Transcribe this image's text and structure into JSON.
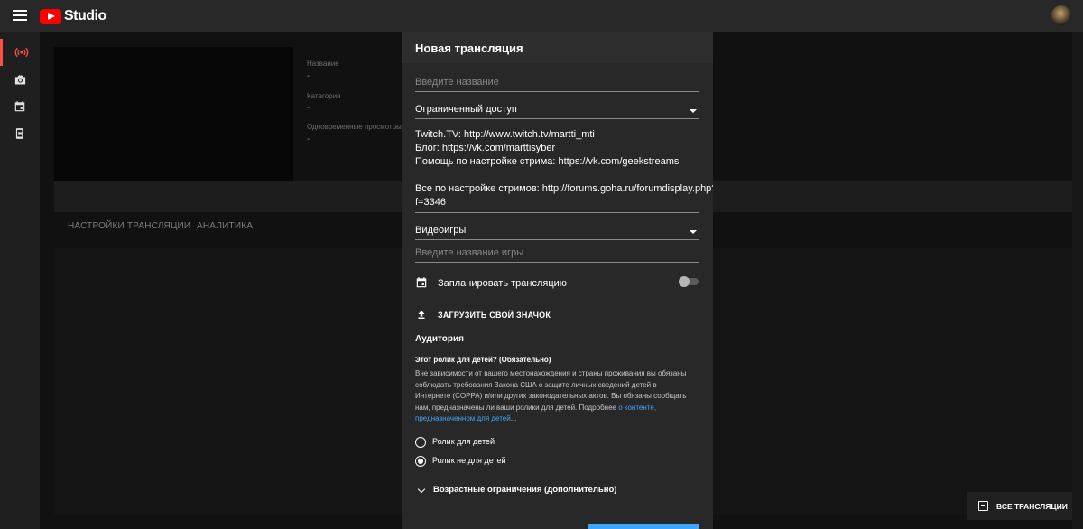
{
  "app": {
    "logo_text": "Studio"
  },
  "icons": {
    "menu": "hamburger-menu-icon",
    "live": "broadcast-icon",
    "camera": "camera-icon",
    "calendar": "calendar-icon",
    "video": "phone-camera-icon",
    "upload": "upload-icon",
    "exit": "exit-icon"
  },
  "colors": {
    "accent": "#3ea6ff",
    "active": "#ff4e45",
    "brand": "#ff0000"
  },
  "stream_info": {
    "name_label": "Название",
    "name_value": "-",
    "category_label": "Категория",
    "category_value": "-",
    "viewers_label": "Одновременные просмотры",
    "viewers_value": "-"
  },
  "tabs": [
    "НАСТРОЙКИ ТРАНСЛЯЦИИ",
    "АНАЛИТИКА"
  ],
  "modal": {
    "title": "Новая трансляция",
    "title_placeholder": "Введите название",
    "visibility": "Ограниченный доступ",
    "description_lines": [
      "Twitch.TV: http://www.twitch.tv/martti_mti",
      "Блог: https://vk.com/marttisyber",
      "Помощь по настройке стрима: https://vk.com/geekstreams",
      "",
      "Все по настройке стримов: http://forums.goha.ru/forumdisplay.php?",
      "f=3346"
    ],
    "category": "Видеоигры",
    "game_placeholder": "Введите название игры",
    "schedule_label": "Запланировать трансляцию",
    "schedule_on": false,
    "upload_label": "ЗАГРУЗИТЬ СВОЙ ЗНАЧОК",
    "audience_heading": "Аудитория",
    "audience_question": "Этот ролик для детей? (Обязательно)",
    "audience_text_lines": [
      "Вне зависимости от вашего местонахождения и страны проживания вы обязаны",
      "соблюдать требования Закона США о защите личных сведений детей в",
      "Интернете (COPPA) и/или других законодательных актов. Вы обязаны сообщать",
      "нам, предназначены ли ваши ролики для детей. Подробнее"
    ],
    "audience_link_start": "о контенте,",
    "audience_link_end": "предназначенном для детей",
    "audience_ellipsis": "...",
    "option_kids": "Ролик для детей",
    "option_not_kids": "Ролик не для детей",
    "selected_option": "not_kids",
    "age_restrictions": "Возрастные ограничения (дополнительно)"
  },
  "footer_button": "ВСЕ ТРАНСЛЯЦИИ"
}
